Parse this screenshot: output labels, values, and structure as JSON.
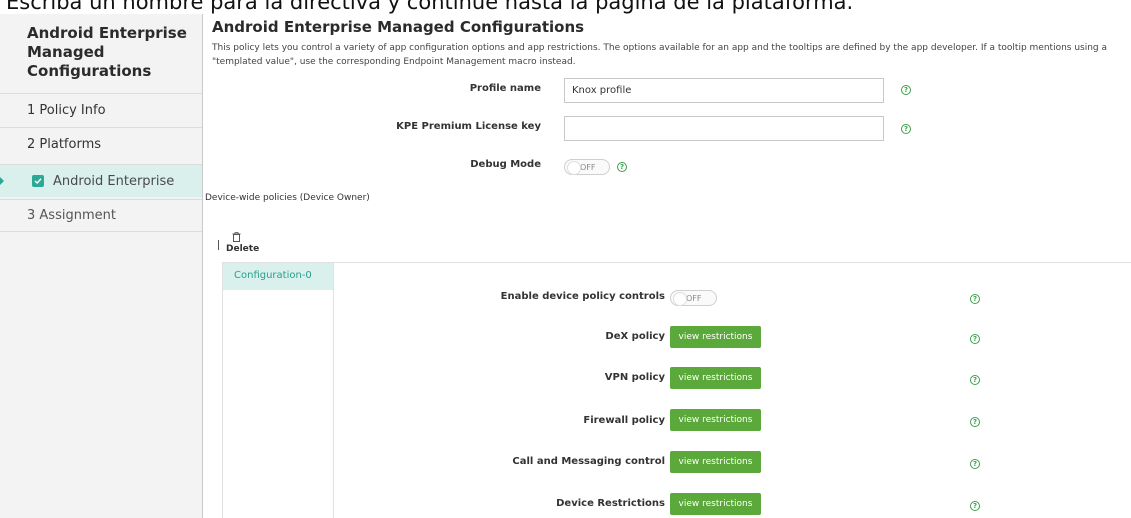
{
  "caption": "Escriba un nombre para la directiva y continúe hasta la página de la plataforma.",
  "sidebar": {
    "title": "Android Enterprise Managed Configurations",
    "items": [
      {
        "label": "1  Policy Info"
      },
      {
        "label": "2  Platforms"
      },
      {
        "label": "Android Enterprise"
      },
      {
        "label": "3  Assignment"
      }
    ]
  },
  "main": {
    "title": "Android Enterprise Managed Configurations",
    "description": "This policy lets you control a variety of app configuration options and app restrictions. The options available for an app and the tooltips are defined by the app developer. If a tooltip mentions using a \"templated value\", use the corresponding Endpoint Management macro instead.",
    "profile_name": {
      "label": "Profile name",
      "value": "Knox profile"
    },
    "kpe_key": {
      "label": "KPE Premium License key",
      "value": ""
    },
    "debug_mode": {
      "label": "Debug Mode",
      "state": "OFF"
    },
    "device_wide_label": "Device-wide policies (Device Owner)",
    "delete_label": "Delete",
    "config_tab": "Configuration-0",
    "policies": {
      "enable_controls": {
        "label": "Enable device policy controls",
        "state": "OFF"
      },
      "dex": {
        "label": "DeX policy",
        "button": "view restrictions"
      },
      "vpn": {
        "label": "VPN policy",
        "button": "view restrictions"
      },
      "firewall": {
        "label": "Firewall policy",
        "button": "view restrictions"
      },
      "call_msg": {
        "label": "Call and Messaging control",
        "button": "view restrictions"
      },
      "device_restrictions": {
        "label": "Device Restrictions",
        "button": "view restrictions"
      }
    },
    "help_glyph": "?"
  },
  "colors": {
    "accent_green": "#5aa93a",
    "teal": "#2ba896",
    "selected_bg": "#d9f0ec"
  },
  "icons": {
    "help": "question-circle-icon",
    "delete": "trash-icon",
    "check": "checkbox-checked-icon"
  }
}
